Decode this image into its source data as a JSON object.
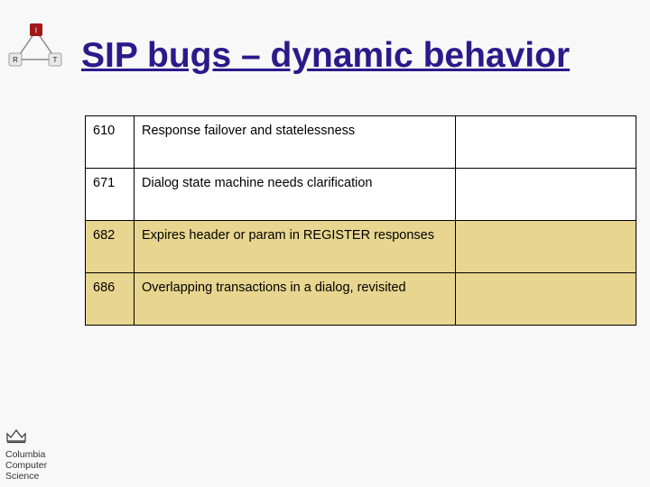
{
  "title": "SIP bugs – dynamic behavior",
  "nodes": {
    "top": "I",
    "left": "R",
    "right": "T"
  },
  "rows": [
    {
      "id": "610",
      "desc": "Response failover and statelessness",
      "note": "",
      "bg": "white"
    },
    {
      "id": "671",
      "desc": "Dialog state machine needs clarification",
      "note": "",
      "bg": "white"
    },
    {
      "id": "682",
      "desc": "Expires header or param in REGISTER responses",
      "note": "",
      "bg": "yellow"
    },
    {
      "id": "686",
      "desc": "Overlapping transactions in a dialog, revisited",
      "note": "",
      "bg": "yellow"
    }
  ],
  "footer": {
    "line1": "Columbia",
    "line2": "Computer",
    "line3": "Science"
  }
}
